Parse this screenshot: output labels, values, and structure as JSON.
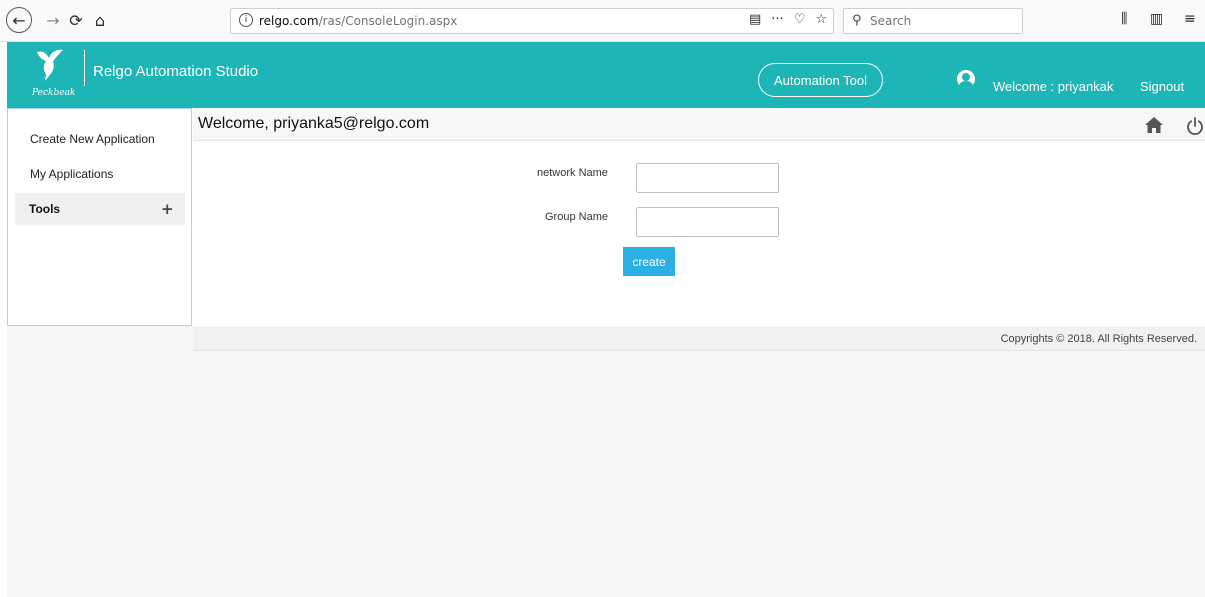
{
  "browser": {
    "url_domain": "relgo.com",
    "url_path": "/ras/ConsoleLogin.aspx",
    "search_placeholder": "Search",
    "info_glyph": "i",
    "more_glyph": "···"
  },
  "header": {
    "logo_text": "Peckbeak",
    "app_title": "Relgo Automation Studio",
    "automation_button": "Automation Tool",
    "welcome_user": "Welcome : priyankak",
    "signout": "Signout",
    "accent_color": "#1db5b5"
  },
  "sidebar": {
    "items": [
      {
        "label": "Create New Application"
      },
      {
        "label": "My Applications"
      }
    ],
    "tools_label": "Tools",
    "tools_expand_glyph": "+"
  },
  "main": {
    "title": "Welcome, priyanka5@relgo.com",
    "form": {
      "network_name_label": "network Name",
      "network_name_value": "",
      "group_name_label": "Group Name",
      "group_name_value": "",
      "create_button": "create",
      "button_color": "#2bb0e4"
    }
  },
  "footer": {
    "copyright": "Copyrights © 2018. All Rights Reserved."
  }
}
